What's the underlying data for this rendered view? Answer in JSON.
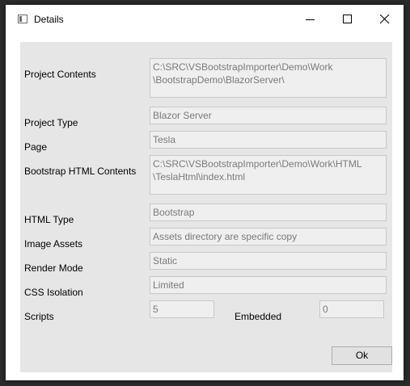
{
  "window": {
    "title": "Details",
    "icon": "window-icon",
    "controls": [
      "minimize-icon",
      "maximize-icon",
      "close-icon"
    ]
  },
  "form": {
    "project_contents": {
      "label": "Project Contents",
      "value": "C:\\SRC\\VSBootstrapImporter\\Demo\\Work\n\\BootstrapDemo\\BlazorServer\\"
    },
    "project_type": {
      "label": "Project Type",
      "value": "Blazor Server"
    },
    "page": {
      "label": "Page",
      "value": "Tesla"
    },
    "bootstrap_html_contents": {
      "label": "Bootstrap HTML Contents",
      "value": "C:\\SRC\\VSBootstrapImporter\\Demo\\Work\\HTML\n\\TeslaHtml\\index.html"
    },
    "html_type": {
      "label": "HTML Type",
      "value": "Bootstrap"
    },
    "image_assets": {
      "label": "Image Assets",
      "value": "Assets directory are specific copy"
    },
    "render_mode": {
      "label": "Render Mode",
      "value": "Static"
    },
    "css_isolation": {
      "label": "CSS Isolation",
      "value": "Limited"
    },
    "scripts": {
      "label": "Scripts",
      "value": "5"
    },
    "embedded": {
      "label": "Embedded",
      "value": "0"
    }
  },
  "buttons": {
    "ok_label": "Ok"
  },
  "colors": {
    "background": "#2b2b2b",
    "window": "#ffffff",
    "panel": "#e6e6e6",
    "field_bg": "#efefef",
    "field_text": "#7a7a7a"
  }
}
